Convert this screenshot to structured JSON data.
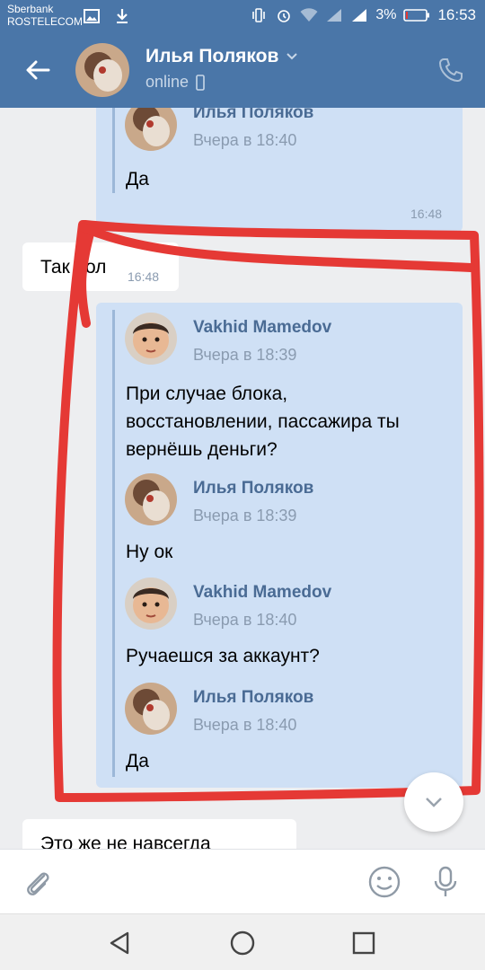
{
  "status_bar": {
    "carrier_line1": "Sberbank",
    "carrier_line2": "ROSTELECOM",
    "battery_percent": "3%",
    "time": "16:53"
  },
  "header": {
    "contact_name": "Илья Поляков",
    "status": "online"
  },
  "messages": {
    "top_forward": {
      "author": "Илья Поляков",
      "date": "Вчера в 18:40",
      "text": "Да",
      "time": "16:48"
    },
    "incoming_1": {
      "text": "Так пол",
      "time": "16:48"
    },
    "forward_group": [
      {
        "author": "Vakhid Mamedov",
        "date": "Вчера в 18:39",
        "line1": "При случае блока,",
        "line2": "восстановлении, пассажира ты",
        "line3": "вернёшь деньги?"
      },
      {
        "author": "Илья Поляков",
        "date": "Вчера в 18:39",
        "text": "Ну ок"
      },
      {
        "author": "Vakhid Mamedov",
        "date": "Вчера в 18:40",
        "text": "Ручаешся за аккаунт?"
      },
      {
        "author": "Илья Поляков",
        "date": "Вчера в 18:40",
        "text": "Да"
      }
    ],
    "incoming_2": {
      "text": "Это же не навсегда"
    }
  },
  "colors": {
    "header_bg": "#4a76a8",
    "outgoing_bubble": "#cfe0f5",
    "annotation_red": "#e53935"
  },
  "icons": {
    "back": "arrow-left-icon",
    "call": "phone-icon",
    "attach": "paperclip-icon",
    "emoji": "smile-icon",
    "mic": "microphone-icon",
    "scroll_down": "chevron-down-icon"
  }
}
